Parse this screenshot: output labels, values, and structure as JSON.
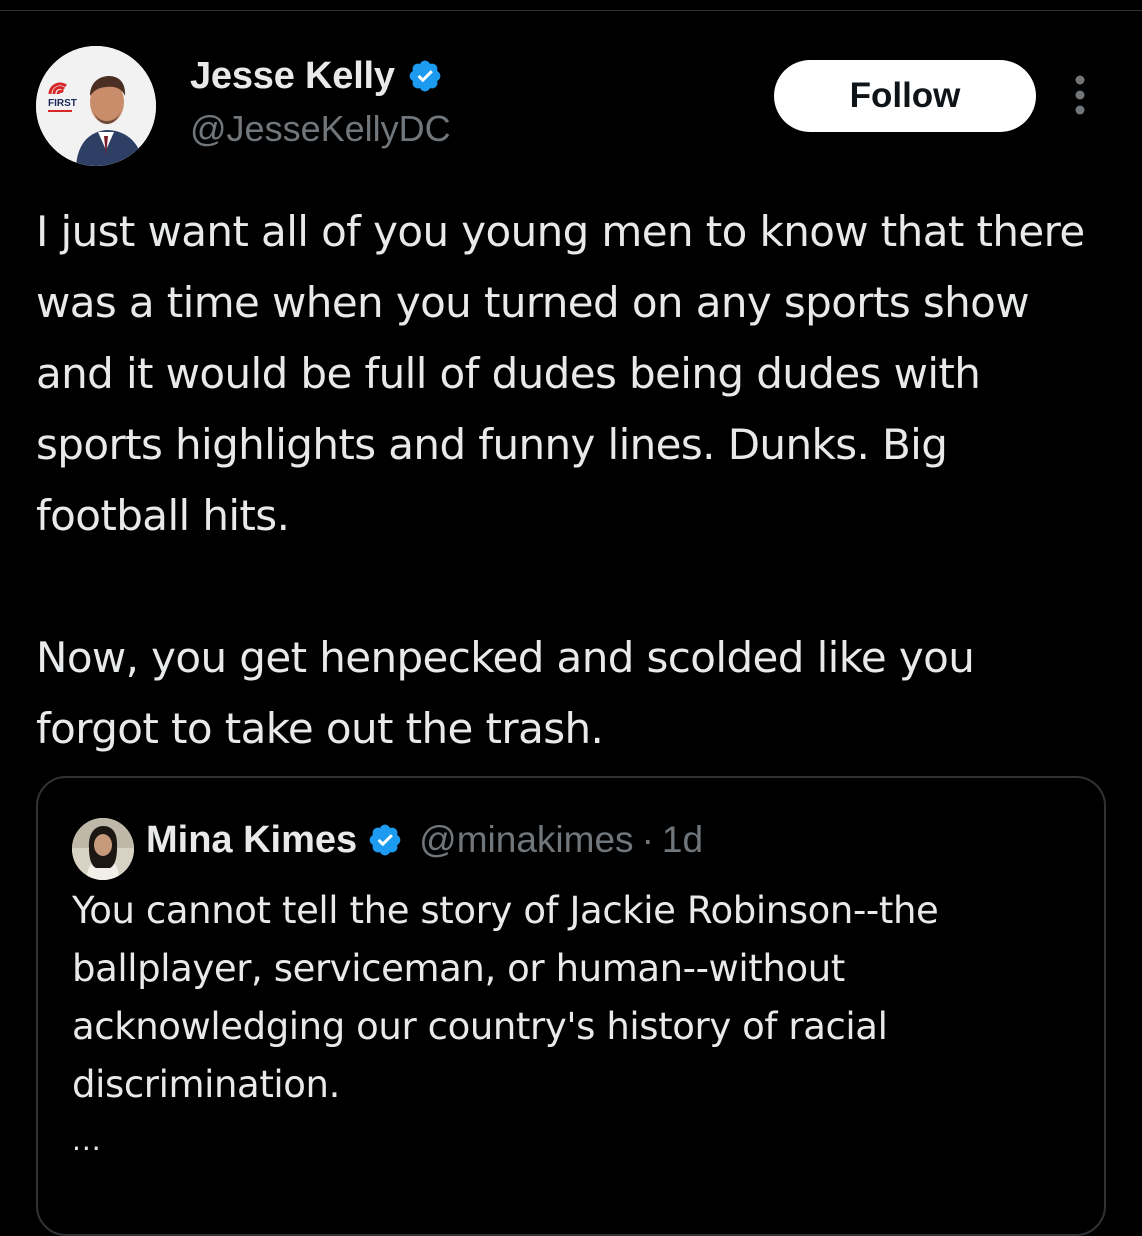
{
  "author": {
    "name": "Jesse Kelly",
    "handle": "@JesseKellyDC",
    "avatar_icon": "profile-photo-icon",
    "verified_icon": "verified-badge-icon",
    "avatar_logo_text": "FIRST"
  },
  "actions": {
    "follow_label": "Follow",
    "more_icon": "more-options-icon"
  },
  "tweet": {
    "paragraphs": [
      "I just want all of you young men to know that there was a time when you turned on any sports show and it would be full of dudes being dudes with sports highlights and funny lines. Dunks. Big football hits.",
      "Now, you get henpecked and scolded like you forgot to take out the trash."
    ]
  },
  "quoted_tweet": {
    "name": "Mina Kimes",
    "handle": "@minakimes",
    "separator": "·",
    "time": "1d",
    "text": "You cannot tell the story of Jackie Robinson--the ballplayer, serviceman, or human--without acknowledging our country's history of racial discrimination.",
    "truncation": "..."
  },
  "colors": {
    "background": "#000000",
    "text": "#e7e9ea",
    "secondary_text": "#71767b",
    "verified_blue": "#1d9bf0",
    "border": "#2f3336",
    "follow_bg": "#ffffff",
    "follow_text": "#0f1419"
  }
}
